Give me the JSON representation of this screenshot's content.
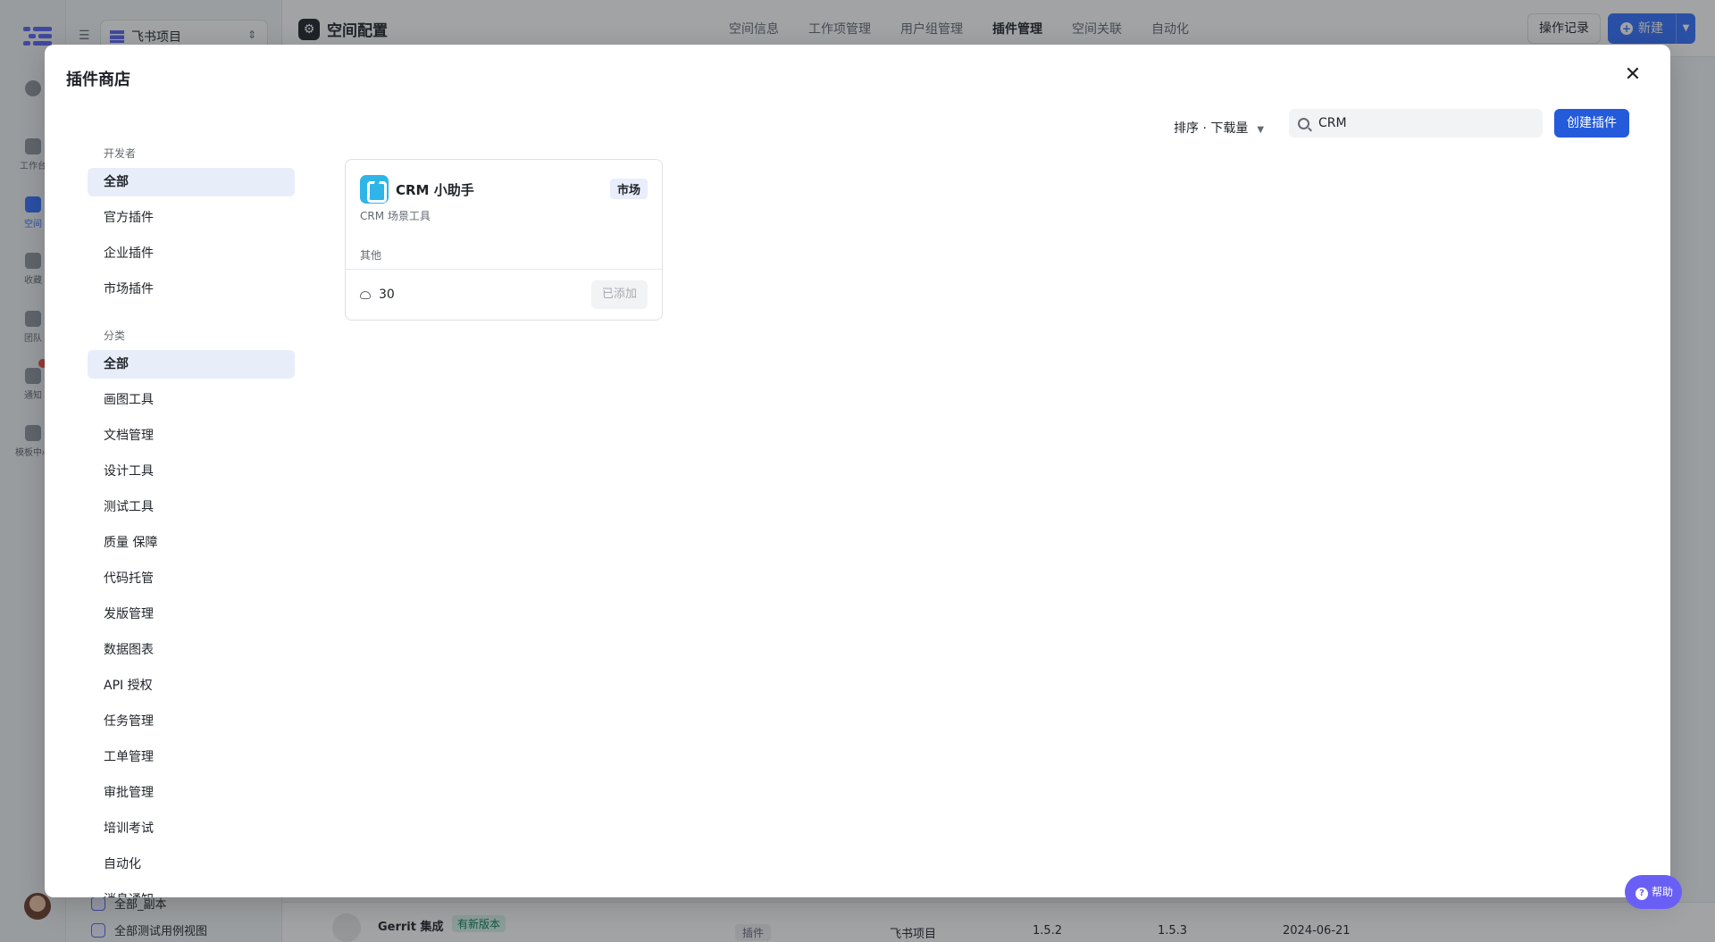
{
  "background": {
    "project": "飞书项目",
    "rail": [
      {
        "label": "工作台"
      },
      {
        "label": "空间"
      },
      {
        "label": "收藏"
      },
      {
        "label": "团队"
      },
      {
        "label": "通知"
      },
      {
        "label": "模板中心"
      }
    ],
    "list_items": [
      "全部_副本",
      "全部测试用例视图"
    ],
    "page_title": "空间配置",
    "nav": [
      {
        "label": "空间信息",
        "active": false
      },
      {
        "label": "工作项管理",
        "active": false
      },
      {
        "label": "用户组管理",
        "active": false
      },
      {
        "label": "插件管理",
        "active": true
      },
      {
        "label": "空间关联",
        "active": false
      },
      {
        "label": "自动化",
        "active": false
      }
    ],
    "log_button": "操作记录",
    "new_button": "新建",
    "row": {
      "name": "Gerrit 集成",
      "tag": "有新版本",
      "type": "插件",
      "space": "飞书项目",
      "version_a": "1.5.2",
      "version_b": "1.5.3",
      "date": "2024-06-21"
    }
  },
  "modal": {
    "title": "插件商店",
    "developer_group": {
      "title": "开发者",
      "items": [
        "全部",
        "官方插件",
        "企业插件",
        "市场插件"
      ],
      "active_index": 0
    },
    "category_group": {
      "title": "分类",
      "items": [
        "全部",
        "画图工具",
        "文档管理",
        "设计工具",
        "测试工具",
        "质量 保障",
        "代码托管",
        "发版管理",
        "数据图表",
        "API 授权",
        "任务管理",
        "工单管理",
        "审批管理",
        "培训考试",
        "自动化",
        "消息通知"
      ],
      "active_index": 0
    },
    "sort_label": "排序 · 下载量",
    "search_value": "CRM",
    "create_button": "创建插件",
    "plugins": [
      {
        "name": "CRM 小助手",
        "tag": "市场",
        "description": "CRM 场景工具",
        "category": "其他",
        "downloads": "30",
        "status_button": "已添加"
      }
    ]
  },
  "help_button": "帮助",
  "colors": {
    "primary": "#245bdb",
    "accent": "#3370ff",
    "help": "#6a5ff5",
    "active_filter_bg": "#e8edfa"
  }
}
